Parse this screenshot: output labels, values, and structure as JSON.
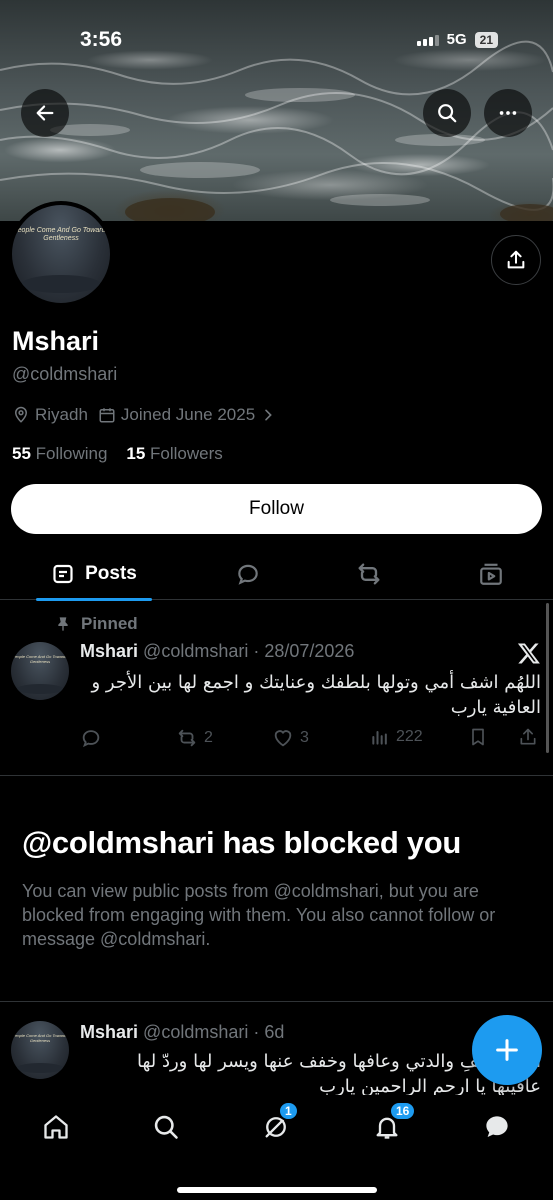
{
  "status_bar": {
    "time": "3:56",
    "network": "5G",
    "battery": "21"
  },
  "profile": {
    "avatar_text": "People Come And Go Towards Gentleness",
    "name": "Mshari",
    "handle": "@coldmshari",
    "location": "Riyadh",
    "joined": "Joined June 2025",
    "following_count": "55",
    "following_label": "Following",
    "followers_count": "15",
    "followers_label": "Followers",
    "follow_button": "Follow"
  },
  "tabs": [
    {
      "label": "Posts",
      "icon": "posts-icon",
      "active": true
    },
    {
      "label": "",
      "icon": "replies-icon"
    },
    {
      "label": "",
      "icon": "reposts-icon"
    },
    {
      "label": "",
      "icon": "media-icon"
    }
  ],
  "pinned_post": {
    "pinned_label": "Pinned",
    "author": "Mshari",
    "handle_date": "@coldmshari · 28/07/2026",
    "text": "اللهُم اشف أمي وتولها بلطفك وعنايتك و اجمع لها بين الأجر و العافية يارب",
    "retweets": "2",
    "likes": "3",
    "views": "222"
  },
  "blocked": {
    "title": "@coldmshari has blocked you",
    "text": "You can view public posts from @coldmshari, but you are blocked from engaging with them. You also cannot follow or message @coldmshari."
  },
  "second_post": {
    "author": "Mshari",
    "handle_date": "@coldmshari · 6d",
    "text": "اللهم اشفِ والدتي وعافها وخفف عنها ويسر لها وردّ لها عافيتها يا ارحم الراحمين يارب"
  },
  "bottom_nav": {
    "grok_badge": "1",
    "notifications_badge": "16"
  },
  "colors": {
    "accent": "#1d9bf0",
    "background": "#000000",
    "muted": "#71767b"
  }
}
